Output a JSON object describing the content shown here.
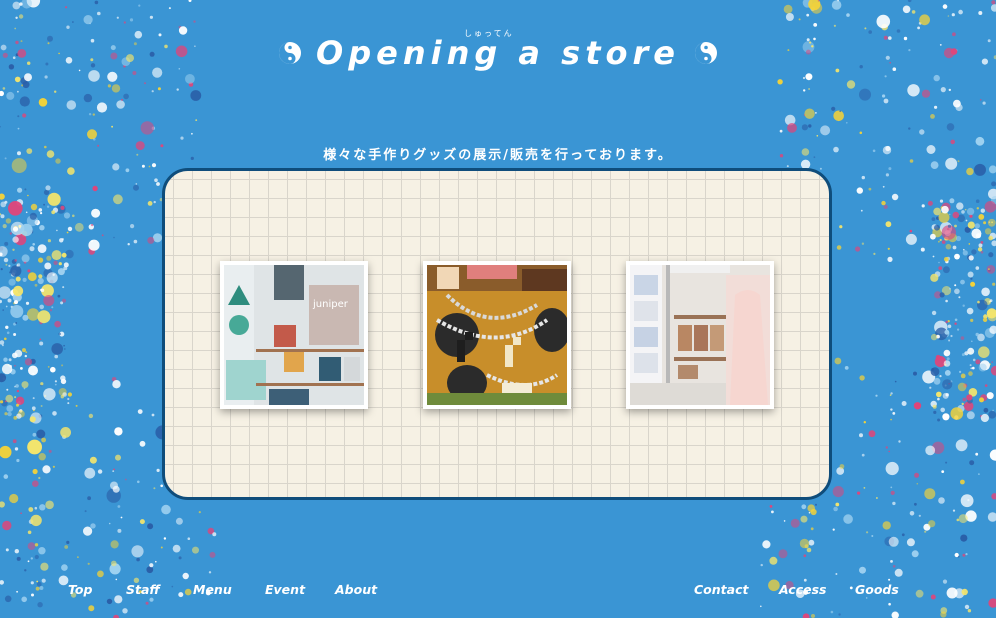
{
  "header": {
    "title": "Opening a store",
    "ruby": "しゅってん",
    "subtitle": "様々な手作りグッズの展示/販売を行っております。"
  },
  "gallery": {
    "photos": [
      {
        "icon": "shop-shelf-photo"
      },
      {
        "icon": "accessory-photo"
      },
      {
        "icon": "display-rack-photo"
      }
    ]
  },
  "nav": {
    "left": [
      "Top",
      "Staff",
      "Menu",
      "Event",
      "About"
    ],
    "right": [
      "Contact",
      "Access",
      "Goods"
    ]
  },
  "colors": {
    "background": "#3a95d4",
    "board": "#f6f1e4",
    "board_border": "#0f4d7b",
    "text": "#ffffff"
  }
}
